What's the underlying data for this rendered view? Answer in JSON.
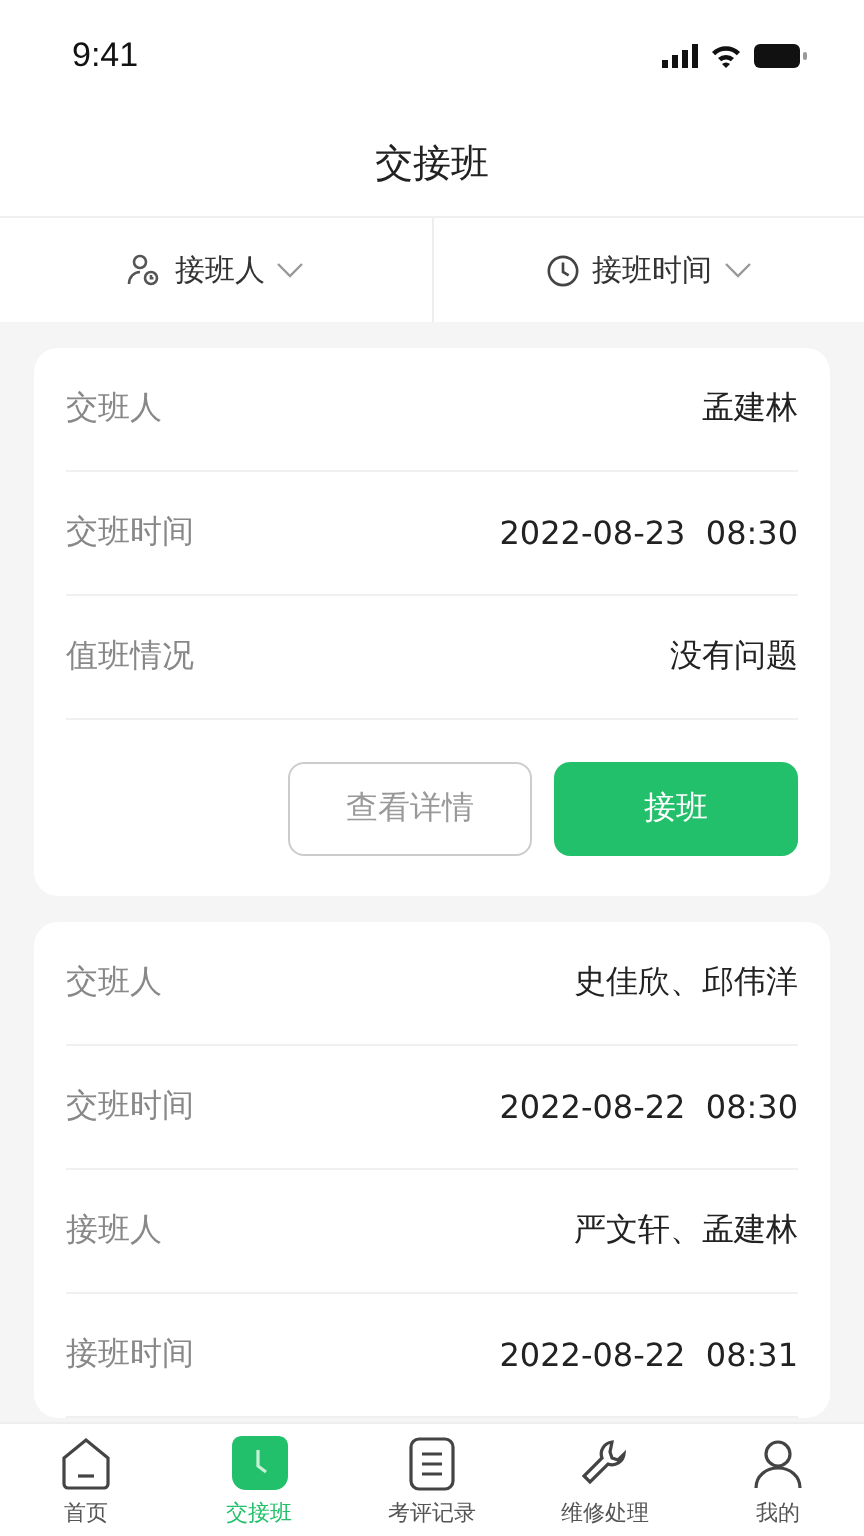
{
  "status_bar": {
    "time": "9:41"
  },
  "title": "交接班",
  "filters": [
    {
      "kind": "person",
      "label": "接班人"
    },
    {
      "kind": "clock",
      "label": "接班时间"
    }
  ],
  "records": [
    {
      "fields": [
        {
          "label": "交班人",
          "value": "孟建林"
        },
        {
          "label": "交班时间",
          "value": "2022-08-23  08:30"
        },
        {
          "label": "值班情况",
          "value": "没有问题"
        }
      ],
      "buttons": [
        {
          "kind": "outline",
          "label": "查看详情"
        },
        {
          "kind": "primary",
          "label": "接班"
        }
      ]
    },
    {
      "fields": [
        {
          "label": "交班人",
          "value": "史佳欣、邱伟洋"
        },
        {
          "label": "交班时间",
          "value": "2022-08-22  08:30"
        },
        {
          "label": "接班人",
          "value": "严文轩、孟建林"
        },
        {
          "label": "接班时间",
          "value": "2022-08-22  08:31"
        }
      ]
    }
  ],
  "tabs": [
    {
      "kind": "home",
      "label": "首页",
      "selected": false
    },
    {
      "kind": "clock",
      "label": "交接班",
      "selected": true
    },
    {
      "kind": "list",
      "label": "考评记录",
      "selected": false
    },
    {
      "kind": "wrench",
      "label": "维修处理",
      "selected": false
    },
    {
      "kind": "person",
      "label": "我的",
      "selected": false
    }
  ]
}
